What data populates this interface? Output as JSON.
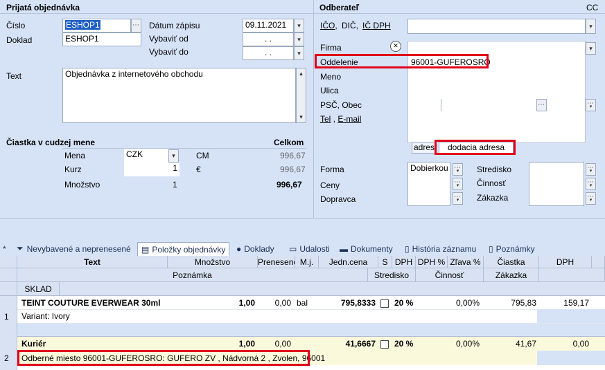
{
  "left": {
    "section_title": "Prijatá objednávka",
    "cislo_label": "Číslo",
    "cislo_value": "ESHOP1",
    "doklad_label": "Doklad",
    "doklad_value": "ESHOP1",
    "datum_label": "Dátum zápisu",
    "datum_value": "09.11.2021",
    "vybavit_od_label": "Vybaviť od",
    "vybavit_od_value": ". .",
    "vybavit_do_label": "Vybaviť do",
    "vybavit_do_value": ". .",
    "text_label": "Text",
    "text_value": "Objednávka z internetového obchodu",
    "ciastka_title": "Čiastka v cudzej mene",
    "celkom_label": "Celkom",
    "mena_label": "Mena",
    "mena_value": "CZK",
    "cm_label": "CM",
    "cm_value": "996,67",
    "kurz_label": "Kurz",
    "kurz_value": "1",
    "eur_label": "€",
    "eur_value": "996,67",
    "mnozstvo_label": "Množstvo",
    "mnozstvo_value": "1",
    "total_value": "996,67"
  },
  "right": {
    "section_title": "Odberateľ",
    "cc_label": "CC",
    "ico_label": "IČO",
    "dic_label": "DIČ",
    "icdph_label": "IČ DPH",
    "firma_label": "Firma",
    "oddelenie_label": "Oddelenie",
    "oddelenie_value": "96001-GUFEROSRO",
    "meno_label": "Meno",
    "ulica_label": "Ulica",
    "psc_label": "PSČ, Obec",
    "tel_label": "Tel",
    "email_label": "E-mail",
    "addr_tab1": "adres",
    "addr_tab2": "dodacia adresa",
    "forma_label": "Forma",
    "forma_value": "Dobierkou",
    "ceny_label": "Ceny",
    "dopravca_label": "Dopravca",
    "stredisko_label": "Stredisko",
    "cinnost_label": "Činnosť",
    "zakazka_label": "Zákazka"
  },
  "tabs": [
    {
      "label": "*"
    },
    {
      "label": "Nevybavené a neprenesené"
    },
    {
      "label": "Položky objednávky"
    },
    {
      "label": "Doklady"
    },
    {
      "label": "Udalosti"
    },
    {
      "label": "Dokumenty"
    },
    {
      "label": "História záznamu"
    },
    {
      "label": "Poznámky"
    }
  ],
  "grid": {
    "headers": {
      "text": "Text",
      "mnozstvo": "Množstvo",
      "prenesene": "Prenesené",
      "mj": "M.j.",
      "jedn_cena": "Jedn.cena",
      "s": "S",
      "dph": "DPH",
      "dph_pct": "DPH %",
      "zlava": "Zľava %",
      "ciastka": "Čiastka",
      "dph2": "DPH",
      "poznamka": "Poznámka",
      "stredisko": "Stredisko",
      "cinnost": "Činnosť",
      "zakazka": "Zákazka",
      "sklad": "SKLAD"
    },
    "rows": [
      {
        "num": "1",
        "text": "TEINT COUTURE EVERWEAR 30ml",
        "mnozstvo": "1,00",
        "prenesene": "0,00",
        "mj": "bal",
        "jedn_cena": "795,8333",
        "dph": "20 %",
        "zlava": "0,00%",
        "ciastka": "795,83",
        "dph_amt": "159,17",
        "note": "Variant: Ivory"
      },
      {
        "num": "2",
        "text": "Kuriér",
        "mnozstvo": "1,00",
        "prenesene": "0,00",
        "mj": "",
        "jedn_cena": "41,6667",
        "dph": "20 %",
        "zlava": "0,00%",
        "ciastka": "41,67",
        "dph_amt": "0,00",
        "note": "Odberné miesto 96001-GUFEROSRO: GUFERO ZV , Nádvorná 2 , Zvolen, 96001"
      }
    ]
  }
}
